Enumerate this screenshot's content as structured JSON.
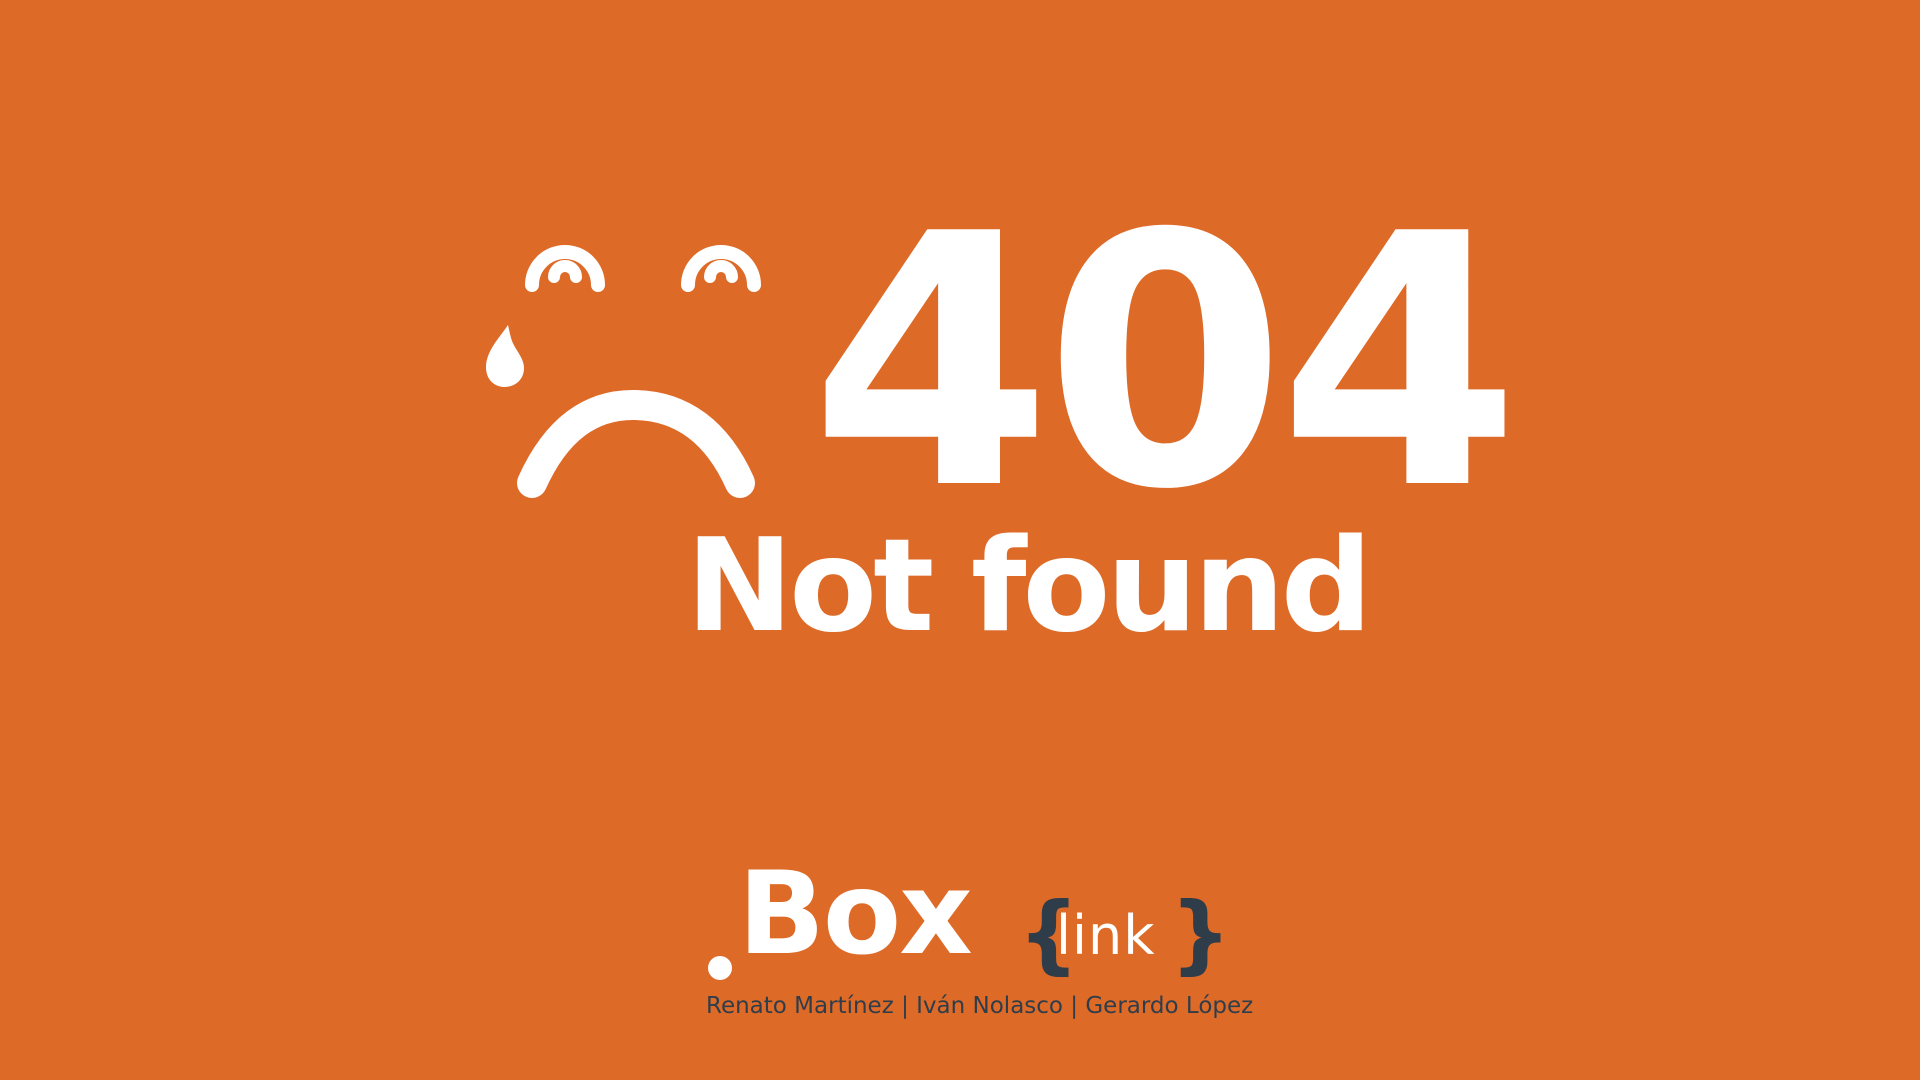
{
  "error": {
    "code": "404",
    "message": "Not found"
  },
  "face": {
    "icon": "sad-crying-face-icon",
    "color": "#FFFFFF"
  },
  "brand": {
    "dot": ".",
    "name": "Box",
    "brace_open": "{",
    "sub": "link",
    "brace_close": "}",
    "credits": "Renato Martínez | Iván Nolasco | Gerardo López"
  },
  "colors": {
    "background": "#DE6A27",
    "foreground": "#FFFFFF",
    "accent_dark": "#2F3D4A"
  }
}
